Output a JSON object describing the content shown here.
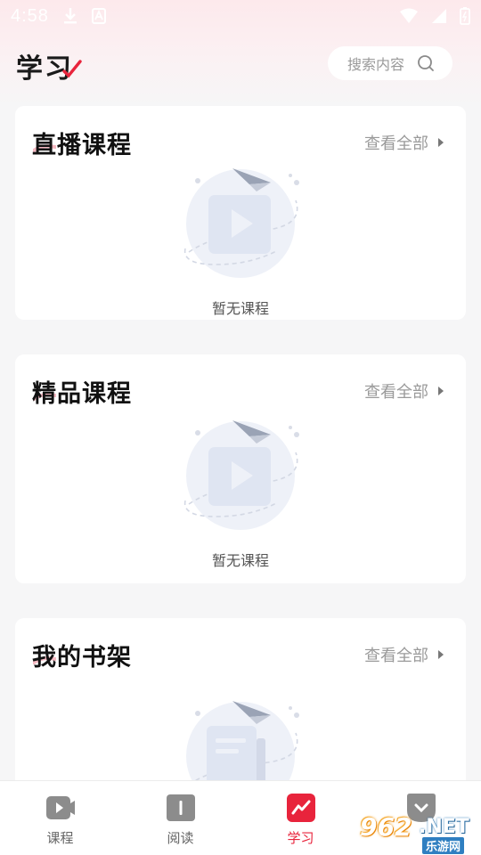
{
  "status_bar": {
    "time": "4:58"
  },
  "header": {
    "title": "学习",
    "search_placeholder": "搜索内容"
  },
  "sections": [
    {
      "title": "直播课程",
      "view_all": "查看全部",
      "empty_text": "暂无课程"
    },
    {
      "title": "精品课程",
      "view_all": "查看全部",
      "empty_text": "暂无课程"
    },
    {
      "title": "我的书架",
      "view_all": "查看全部"
    }
  ],
  "bottom_nav": [
    {
      "label": "课程",
      "icon": "video-play-icon",
      "active": false
    },
    {
      "label": "阅读",
      "icon": "book-icon",
      "active": false
    },
    {
      "label": "学习",
      "icon": "learning-chart-icon",
      "active": true
    },
    {
      "label": "",
      "icon": "profile-icon",
      "active": false
    }
  ],
  "watermark": {
    "number": "962",
    "suffix": ".NET",
    "site": "乐游网"
  },
  "colors": {
    "accent": "#e8243c",
    "illustration_bg": "#eef1f8",
    "muted_text": "#9a9a9a"
  }
}
